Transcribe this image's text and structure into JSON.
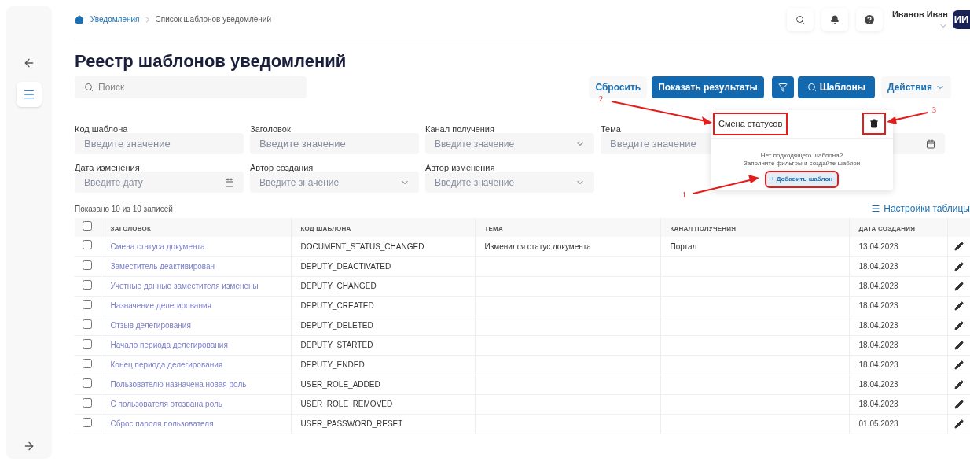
{
  "breadcrumbs": [
    {
      "label": "Уведомления",
      "link": true
    },
    {
      "label": "Список шаблонов уведомлений",
      "link": false
    }
  ],
  "user": {
    "name": "Иванов Иван",
    "initials": "ИИ"
  },
  "title": "Реестр шаблонов уведомлений",
  "search": {
    "placeholder": "Поиск"
  },
  "toolbar": {
    "reset": "Сбросить",
    "show": "Показать результаты",
    "templates": "Шаблоны",
    "actions": "Действия"
  },
  "filters": [
    {
      "label": "Код шаблона",
      "placeholder": "Введите значение",
      "kind": "text"
    },
    {
      "label": "Заголовок",
      "placeholder": "Введите значение",
      "kind": "text"
    },
    {
      "label": "Канал получения",
      "placeholder": "Введите значение",
      "kind": "select"
    },
    {
      "label": "Тема",
      "placeholder": "Введите значение",
      "kind": "text"
    },
    {
      "kind": "date"
    },
    {
      "label": "Дата изменения",
      "placeholder": "Введите дату",
      "kind": "date"
    },
    {
      "label": "Автор создания",
      "placeholder": "Введите значение",
      "kind": "select"
    },
    {
      "label": "Автор изменения",
      "placeholder": "Введите значение",
      "kind": "select"
    }
  ],
  "popover": {
    "template_name": "Смена статусов",
    "name_highlighted": true,
    "delete_highlighted": true,
    "hint_line_1": "Нет подходящего шаблона?",
    "hint_line_2": "Заполните фильтры и создайте шаблон",
    "add_button": "+ Добавить шаблон",
    "add_highlighted": true
  },
  "annotations": [
    {
      "label": "2"
    },
    {
      "label": "3"
    },
    {
      "label": "1"
    }
  ],
  "records_info": "Показано 10 из 10 записей",
  "table_settings": "Настройки таблицы",
  "table": {
    "columns": [
      "ЗАГОЛОВОК",
      "КОД ШАБЛОНА",
      "ТЕМА",
      "КАНАЛ ПОЛУЧЕНИЯ",
      "ДАТА СОЗДАНИЯ"
    ],
    "all_checked": false,
    "rows": [
      {
        "checked": false,
        "title": "Смена статуса документа",
        "code": "DOCUMENT_STATUS_CHANGED",
        "topic": "Изменился статус документа",
        "channel": "Портал",
        "date": "13.04.2023"
      },
      {
        "checked": false,
        "title": "Заместитель деактивирован",
        "code": "DEPUTY_DEACTIVATED",
        "date": "18.04.2023"
      },
      {
        "checked": false,
        "title": "Учетные данные заместителя изменены",
        "code": "DEPUTY_CHANGED",
        "date": "18.04.2023"
      },
      {
        "checked": false,
        "title": "Назначение делегирования",
        "code": "DEPUTY_CREATED",
        "date": "18.04.2023"
      },
      {
        "checked": false,
        "title": "Отзыв делегирования",
        "code": "DEPUTY_DELETED",
        "date": "18.04.2023"
      },
      {
        "checked": false,
        "title": "Начало периода делегирования",
        "code": "DEPUTY_STARTED",
        "date": "18.04.2023"
      },
      {
        "checked": false,
        "title": "Конец периода делегирования",
        "code": "DEPUTY_ENDED",
        "date": "18.04.2023"
      },
      {
        "checked": false,
        "title": "Пользователю назначена новая роль",
        "code": "USER_ROLE_ADDED",
        "date": "18.04.2023"
      },
      {
        "checked": false,
        "title": "С пользователя отозвана роль",
        "code": "USER_ROLE_REMOVED",
        "date": "18.04.2023"
      },
      {
        "checked": false,
        "title": "Сброс пароля пользователя",
        "code": "USER_PASSWORD_RESET",
        "date": "01.05.2023"
      }
    ]
  }
}
